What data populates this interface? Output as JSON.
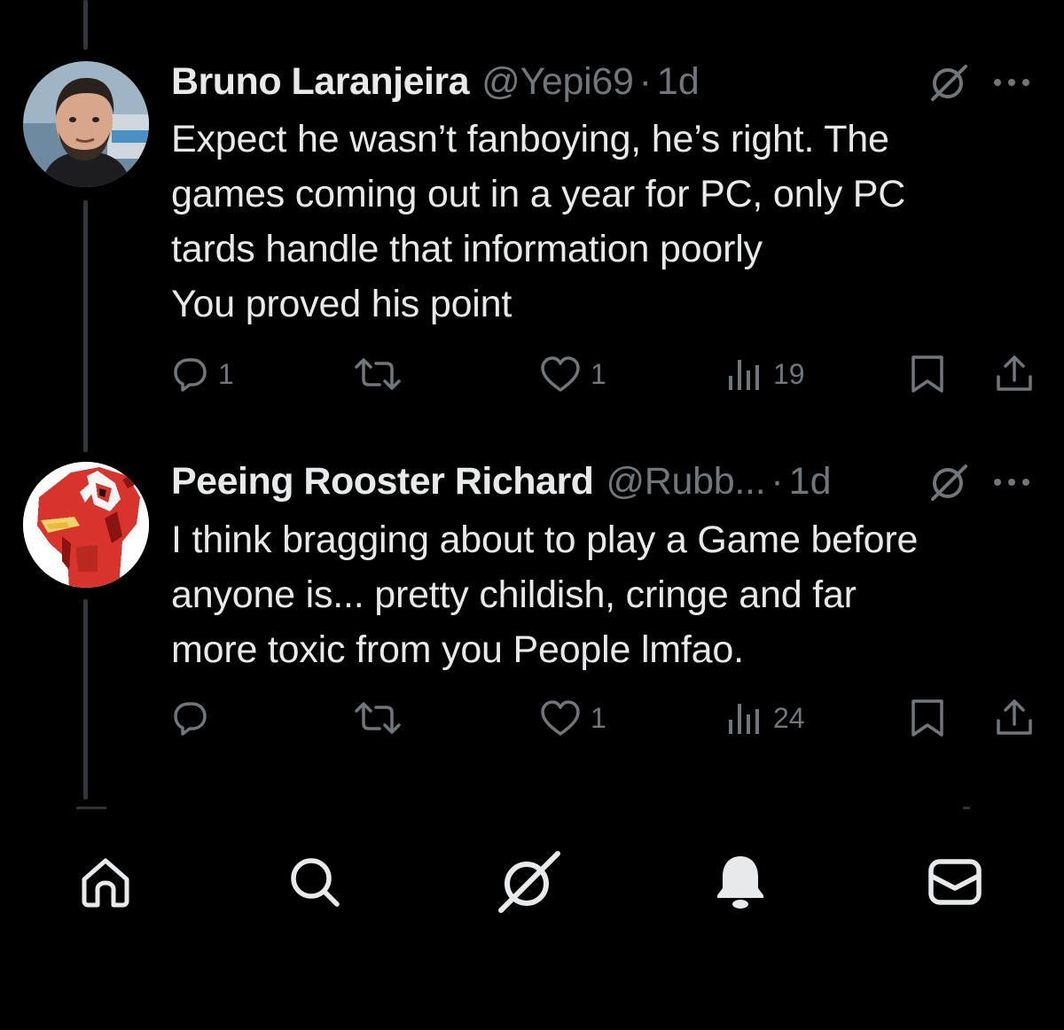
{
  "tweets": [
    {
      "display_name": "Bruno Laranjeira",
      "handle": "@Yepi69",
      "separator": "·",
      "time": "1d",
      "avatar_icon": "profile-photo",
      "text_lines": [
        "Expect he wasn’t fanboying, he’s right. The",
        "games coming out in a year for PC, only PC",
        "tards handle that information poorly",
        "You proved his point"
      ],
      "actions": {
        "replies": "1",
        "reposts": "",
        "likes": "1",
        "views": "19"
      }
    },
    {
      "display_name": "Peeing Rooster Richard",
      "handle": "@Rubb...",
      "separator": "·",
      "time": "1d",
      "avatar_icon": "rooster-pixel-art",
      "text_lines": [
        "I think bragging about to play a Game before",
        "anyone is... pretty childish, cringe and far",
        "more toxic from you People lmfao."
      ],
      "actions": {
        "replies": "",
        "reposts": "",
        "likes": "1",
        "views": "24"
      }
    }
  ],
  "icons": {
    "reply": "reply-icon",
    "repost": "repost-icon",
    "like": "like-icon",
    "views": "views-icon",
    "bookmark": "bookmark-icon",
    "share": "share-icon",
    "grok": "grok-icon",
    "more": "more-icon"
  },
  "bottom_nav": [
    {
      "name": "home",
      "icon": "home-icon"
    },
    {
      "name": "search",
      "icon": "search-icon"
    },
    {
      "name": "grok",
      "icon": "grok-icon"
    },
    {
      "name": "notifications",
      "icon": "bell-icon"
    },
    {
      "name": "messages",
      "icon": "mail-icon"
    }
  ],
  "colors": {
    "background": "#000000",
    "text_primary": "#e7e9ea",
    "text_secondary": "#71767b",
    "thread_line": "#333639"
  }
}
